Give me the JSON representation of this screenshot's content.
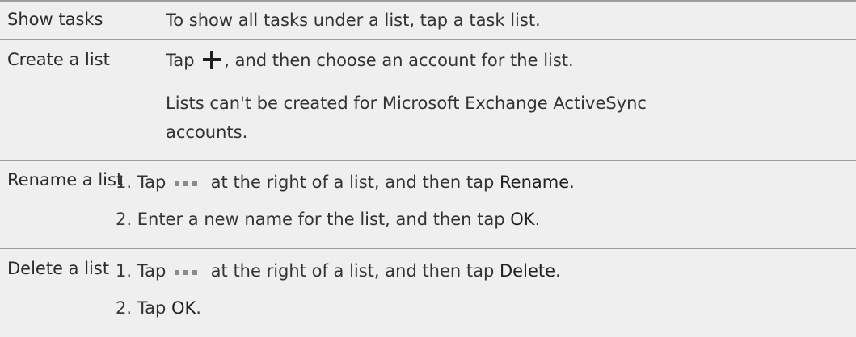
{
  "rows": [
    {
      "label": "Show tasks",
      "text": "To show all tasks under a list, tap a task list."
    },
    {
      "label": "Create a list",
      "text_before": "Tap",
      "text_after": ", and then choose an account for the list.",
      "note_line1": "Lists can't be created for Microsoft Exchange ActiveSync",
      "note_line2": "accounts."
    },
    {
      "label": "Rename a list",
      "steps": [
        {
          "num": "1.",
          "before": "Tap",
          "middle": "at the right of a list, and then tap",
          "emphasis": "Rename",
          "end": "."
        },
        {
          "num": "2.",
          "before": "Enter a new name for the list, and then tap",
          "emphasis": "OK",
          "end": "."
        }
      ]
    },
    {
      "label": "Delete a list",
      "steps": [
        {
          "num": "1.",
          "before": "Tap",
          "middle": "at the right of a list, and then tap",
          "emphasis": "Delete",
          "end": "."
        },
        {
          "num": "2.",
          "before": "Tap",
          "emphasis": "OK",
          "end": "."
        }
      ]
    }
  ],
  "icons": {
    "add": "plus-icon",
    "more": "more-icon"
  }
}
